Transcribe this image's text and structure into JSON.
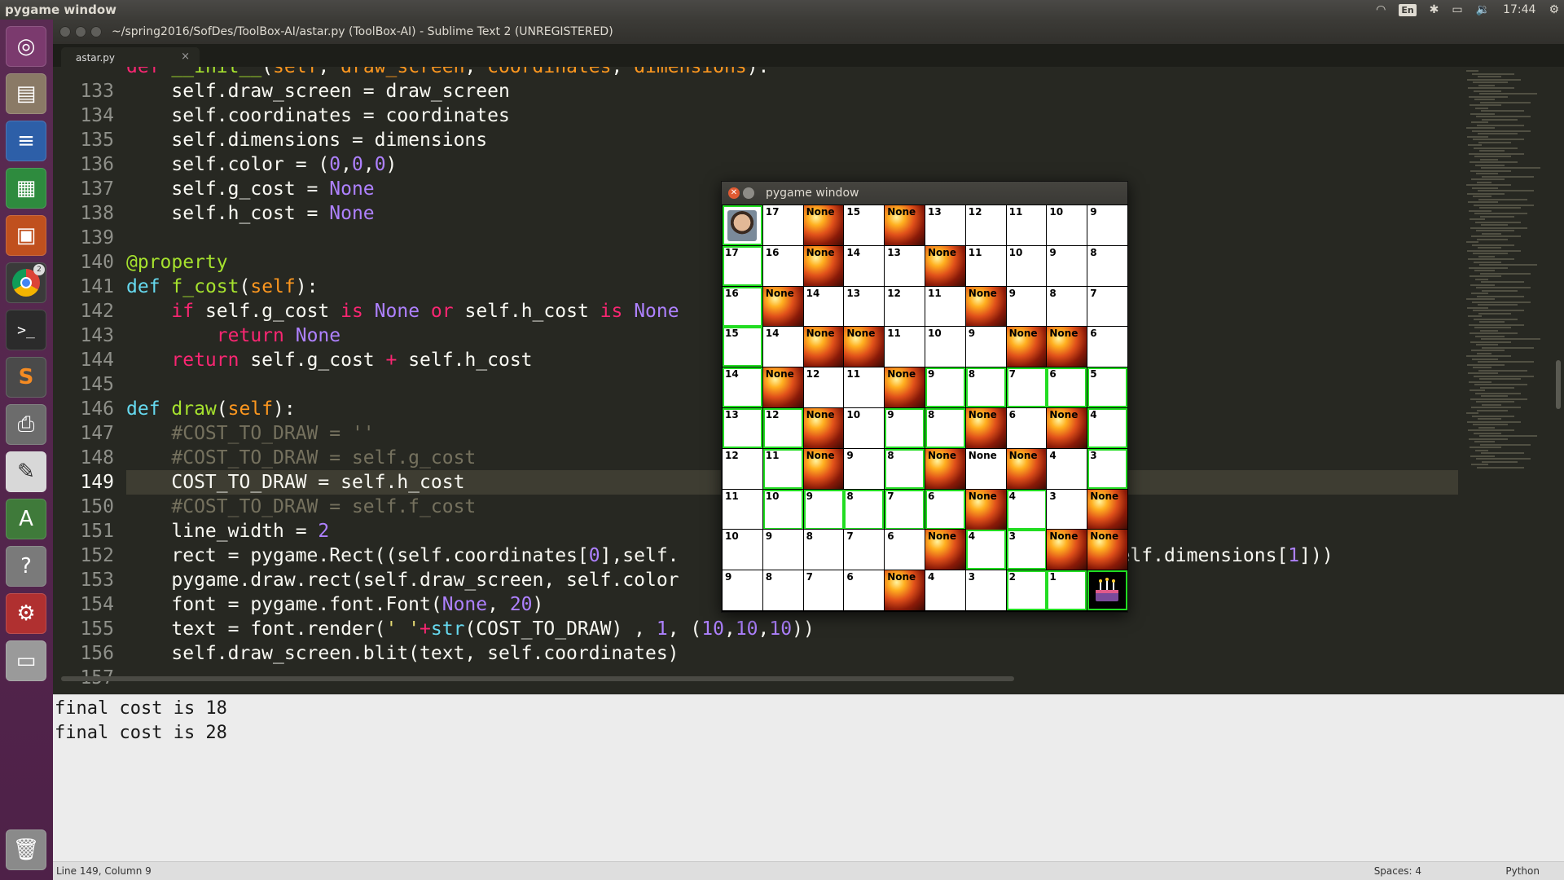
{
  "top_panel": {
    "app_title": "pygame window",
    "lang": "En",
    "time": "17:44",
    "icons": [
      "wifi-icon",
      "bluetooth-icon",
      "battery-icon",
      "volume-icon",
      "gear-icon"
    ]
  },
  "launcher": {
    "chrome_badge": "2",
    "items": [
      "ubuntu-dash-icon",
      "files-icon",
      "writer-icon",
      "calc-icon",
      "impress-icon",
      "chrome-icon",
      "terminal-icon",
      "sublime-icon",
      "scanner-icon",
      "text-editor-icon",
      "software-center-icon",
      "help-icon",
      "settings-icon",
      "drive-icon",
      "trash-icon"
    ]
  },
  "window": {
    "title": "~/spring2016/SofDes/ToolBox-AI/astar.py (ToolBox-AI) - Sublime Text 2 (UNREGISTERED)"
  },
  "tabs": [
    {
      "label": "astar.py",
      "close": "×"
    }
  ],
  "editor": {
    "partial_top_line": "    def __init__(self, draw_screen, coordinates, dimensions):",
    "lines": [
      {
        "n": "133"
      },
      {
        "n": "134"
      },
      {
        "n": "135"
      },
      {
        "n": "136"
      },
      {
        "n": "137"
      },
      {
        "n": "138"
      },
      {
        "n": "139"
      },
      {
        "n": "140"
      },
      {
        "n": "141"
      },
      {
        "n": "142"
      },
      {
        "n": "143"
      },
      {
        "n": "144"
      },
      {
        "n": "145"
      },
      {
        "n": "146"
      },
      {
        "n": "147"
      },
      {
        "n": "148"
      },
      {
        "n": "149"
      },
      {
        "n": "150"
      },
      {
        "n": "151"
      },
      {
        "n": "152"
      },
      {
        "n": "153"
      },
      {
        "n": "154"
      },
      {
        "n": "155"
      },
      {
        "n": "156"
      },
      {
        "n": "157"
      }
    ],
    "active_line": "149"
  },
  "console": {
    "lines": [
      "final cost is 18",
      "final cost is 28"
    ]
  },
  "status": {
    "position": "Line 149, Column 9",
    "spaces": "Spaces: 4",
    "syntax": "Python"
  },
  "pygame": {
    "title": "pygame window",
    "grid": [
      [
        "S",
        "17",
        "None",
        "15",
        "None",
        "13",
        "12",
        "11",
        "10",
        "9"
      ],
      [
        "17",
        "16",
        "None",
        "14",
        "13",
        "None",
        "11",
        "10",
        "9",
        "8"
      ],
      [
        "16",
        "None",
        "14",
        "13",
        "12",
        "11",
        "None",
        "9",
        "8",
        "7"
      ],
      [
        "15",
        "14",
        "None",
        "None",
        "11",
        "10",
        "9",
        "None",
        "None",
        "6"
      ],
      [
        "14",
        "None",
        "12",
        "11",
        "None",
        "9",
        "8",
        "7",
        "6",
        "5"
      ],
      [
        "13",
        "12",
        "None",
        "10",
        "9",
        "8",
        "None",
        "6",
        "None",
        "4"
      ],
      [
        "12",
        "11",
        "None",
        "9",
        "8",
        "None",
        "None",
        "None",
        "4",
        "3"
      ],
      [
        "11",
        "10",
        "9",
        "8",
        "7",
        "6",
        "None",
        "4",
        "3",
        "None"
      ],
      [
        "10",
        "9",
        "8",
        "7",
        "6",
        "None",
        "4",
        "3",
        "None",
        "None"
      ],
      [
        "9",
        "8",
        "7",
        "6",
        "None",
        "4",
        "3",
        "2",
        "1",
        "G"
      ]
    ],
    "walls": [
      [
        0,
        2
      ],
      [
        0,
        4
      ],
      [
        1,
        2
      ],
      [
        1,
        5
      ],
      [
        2,
        1
      ],
      [
        2,
        6
      ],
      [
        3,
        2
      ],
      [
        3,
        3
      ],
      [
        3,
        7
      ],
      [
        3,
        8
      ],
      [
        4,
        1
      ],
      [
        4,
        4
      ],
      [
        5,
        2
      ],
      [
        5,
        6
      ],
      [
        5,
        8
      ],
      [
        6,
        2
      ],
      [
        6,
        5
      ],
      [
        6,
        7
      ],
      [
        7,
        6
      ],
      [
        7,
        9
      ],
      [
        8,
        5
      ],
      [
        8,
        8
      ],
      [
        8,
        9
      ],
      [
        9,
        4
      ]
    ],
    "path": [
      [
        0,
        0
      ],
      [
        1,
        0
      ],
      [
        2,
        0
      ],
      [
        3,
        0
      ],
      [
        4,
        0
      ],
      [
        5,
        0
      ],
      [
        5,
        1
      ],
      [
        6,
        1
      ],
      [
        7,
        1
      ],
      [
        7,
        2
      ],
      [
        7,
        3
      ],
      [
        7,
        4
      ],
      [
        6,
        4
      ],
      [
        5,
        4
      ],
      [
        5,
        5
      ],
      [
        4,
        5
      ],
      [
        4,
        6
      ],
      [
        4,
        7
      ],
      [
        4,
        8
      ],
      [
        4,
        9
      ],
      [
        5,
        9
      ],
      [
        6,
        9
      ],
      [
        7,
        4
      ],
      [
        7,
        5
      ],
      [
        8,
        7
      ],
      [
        9,
        7
      ],
      [
        9,
        8
      ],
      [
        9,
        9
      ],
      [
        7,
        7
      ],
      [
        8,
        6
      ]
    ],
    "start_icon": "player-avatar-icon",
    "goal_icon": "cake-icon"
  }
}
